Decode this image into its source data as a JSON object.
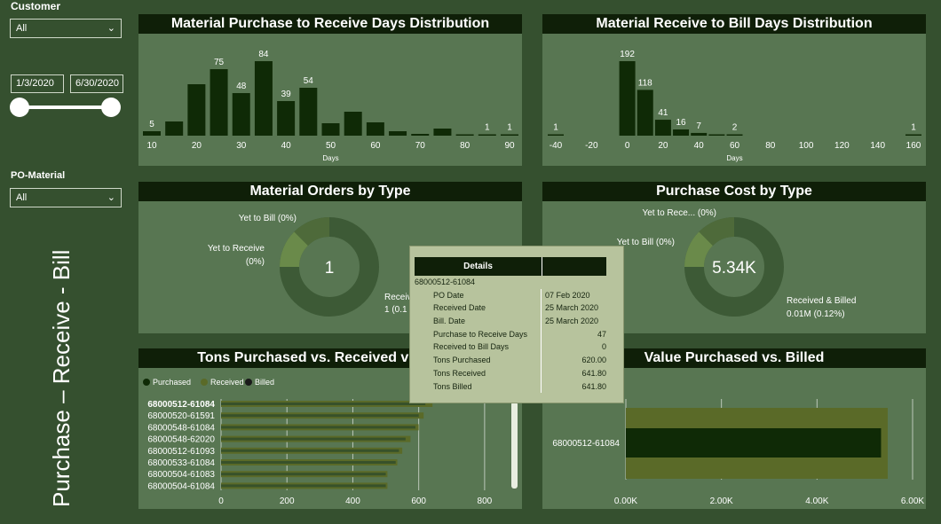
{
  "filters": {
    "customer_label": "Customer",
    "customer_value": "All",
    "date_start": "1/3/2020",
    "date_end": "6/30/2020",
    "po_material_label": "PO-Material",
    "po_material_value": "All"
  },
  "page_title": "Purchase – Receive - Bill",
  "colors": {
    "background": "#35502f",
    "panel": "#587652",
    "title_bar": "#0f1f08",
    "purchased": "#0f2a06",
    "received": "#5a6a28",
    "billed": "#c7d4a8"
  },
  "panels": {
    "p2r_title": "Material Purchase to Receive Days Distribution",
    "r2b_title": "Material Receive to Bill Days Distribution",
    "orders_title": "Material Orders by Type",
    "cost_title": "Purchase Cost by Type",
    "tons_title": "Tons Purchased vs. Received vs. Billed",
    "value_title": "Value Purchased vs. Billed"
  },
  "chart_data": [
    {
      "type": "bar",
      "title": "Material Purchase to Receive Days Distribution",
      "xlabel": "Days",
      "x": [
        10,
        15,
        20,
        25,
        30,
        35,
        40,
        45,
        50,
        55,
        60,
        65,
        70,
        75,
        80,
        85,
        90
      ],
      "values": [
        5,
        16,
        58,
        75,
        48,
        84,
        39,
        54,
        14,
        27,
        15,
        5,
        2,
        8,
        0,
        1,
        1
      ],
      "data_labels": {
        "10": "5",
        "25": "75",
        "30": "48",
        "35": "84",
        "40": "39",
        "45": "54",
        "85": "1",
        "90": "1"
      },
      "ticks": [
        "10",
        "20",
        "30",
        "40",
        "50",
        "60",
        "70",
        "80",
        "90"
      ]
    },
    {
      "type": "bar",
      "title": "Material Receive to Bill Days Distribution",
      "xlabel": "Days",
      "x": [
        -40,
        0,
        10,
        20,
        30,
        40,
        50,
        60,
        160
      ],
      "values": [
        1,
        192,
        118,
        41,
        16,
        7,
        3,
        2,
        1
      ],
      "data_labels": {
        "-40": "1",
        "0": "192",
        "10": "118",
        "20": "41",
        "30": "16",
        "40": "7",
        "60": "2",
        "160": "1"
      },
      "ticks": [
        "-40",
        "-20",
        "0",
        "20",
        "40",
        "60",
        "80",
        "100",
        "120",
        "140",
        "160"
      ]
    },
    {
      "type": "pie",
      "title": "Material Orders by Type",
      "center_label": "1",
      "slices": [
        {
          "name": "Received & Billed",
          "value": 99.8
        },
        {
          "name": "Yet to Receive",
          "value": 0.1
        },
        {
          "name": "Yet to Bill",
          "value": 0.1
        }
      ],
      "labels": [
        "Yet to Bill (0%)",
        "Yet to Receive",
        "(0%)",
        "Receiv",
        "1 (0.1"
      ]
    },
    {
      "type": "pie",
      "title": "Purchase Cost by Type",
      "center_label": "5.34K",
      "slices": [
        {
          "name": "Received & Billed",
          "value": 99.76
        },
        {
          "name": "Yet to Receive",
          "value": 0.12
        },
        {
          "name": "Yet to Bill",
          "value": 0.12
        }
      ],
      "labels": [
        "Yet to Rece... (0%)",
        "Yet to Bill (0%)",
        "Received & Billed",
        "0.01M (0.12%)"
      ]
    },
    {
      "type": "bar",
      "orientation": "horizontal",
      "title": "Tons Purchased vs. Received vs. Billed",
      "legend": [
        "Purchased",
        "Received",
        "Billed"
      ],
      "categories": [
        "68000512-61084",
        "68000520-61591",
        "68000548-61084",
        "68000548-62020",
        "68000512-61093",
        "68000533-61084",
        "68000504-61083",
        "68000504-61084"
      ],
      "series": [
        {
          "name": "Purchased",
          "values": [
            620,
            600,
            590,
            560,
            540,
            530,
            500,
            500
          ]
        },
        {
          "name": "Received",
          "values": [
            641.8,
            615,
            600,
            575,
            550,
            535,
            505,
            505
          ]
        },
        {
          "name": "Billed",
          "values": [
            641.8,
            615,
            600,
            575,
            550,
            535,
            505,
            505
          ]
        }
      ],
      "ticks": [
        "0",
        "200",
        "400",
        "600",
        "800"
      ],
      "xlim": [
        0,
        900
      ]
    },
    {
      "type": "bar",
      "orientation": "horizontal",
      "title": "Value Purchased vs. Billed",
      "categories": [
        "68000512-61084"
      ],
      "series": [
        {
          "name": "Purchased",
          "values": [
            5340
          ]
        },
        {
          "name": "Billed",
          "values": [
            5480
          ]
        }
      ],
      "ticks": [
        "0.00K",
        "2.00K",
        "4.00K",
        "6.00K"
      ],
      "xlim": [
        0,
        6000
      ]
    }
  ],
  "tooltip": {
    "header": "Details",
    "id": "68000512-61084",
    "rows": [
      {
        "k": "PO Date",
        "v": "07 Feb 2020"
      },
      {
        "k": "Received Date",
        "v": "25 March 2020"
      },
      {
        "k": "Bill. Date",
        "v": "25 March 2020"
      },
      {
        "k": "Purchase to Receive Days",
        "v": "47"
      },
      {
        "k": "Received to Bill Days",
        "v": "0"
      },
      {
        "k": "Tons Purchased",
        "v": "620.00"
      },
      {
        "k": "Tons Received",
        "v": "641.80"
      },
      {
        "k": "Tons Billed",
        "v": "641.80"
      }
    ]
  }
}
